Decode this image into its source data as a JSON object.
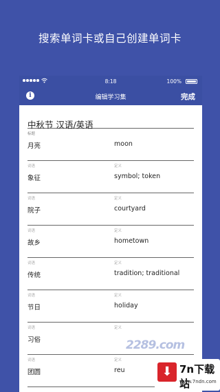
{
  "promo": {
    "headline": "搜索单词卡或自己创建单词卡"
  },
  "statusbar": {
    "time": "8:18",
    "battery": "100%"
  },
  "navbar": {
    "info_glyph": "i",
    "title": "编辑学习集",
    "done_label": "完成"
  },
  "set": {
    "title": "中秋节 汉语/英语",
    "title_label": "标题"
  },
  "columns": {
    "term_label": "词语",
    "def_label": "定义"
  },
  "cards": [
    {
      "term": "月亮",
      "definition": "moon"
    },
    {
      "term": "象征",
      "definition": "symbol; token"
    },
    {
      "term": "院子",
      "definition": "courtyard"
    },
    {
      "term": "故乡",
      "definition": "hometown"
    },
    {
      "term": "传统",
      "definition": "tradition; traditional"
    },
    {
      "term": "节日",
      "definition": "holiday"
    },
    {
      "term": "习俗",
      "definition": ""
    },
    {
      "term": "团圆",
      "definition": "reu"
    }
  ],
  "watermark": {
    "site": "2289.com",
    "brand": "7n下载站",
    "url": "www.7ndn.com",
    "badge_glyph": "⬇"
  },
  "colors": {
    "background": "#3f52a8",
    "bar": "#3b4fa3",
    "badge": "#d9252b"
  }
}
